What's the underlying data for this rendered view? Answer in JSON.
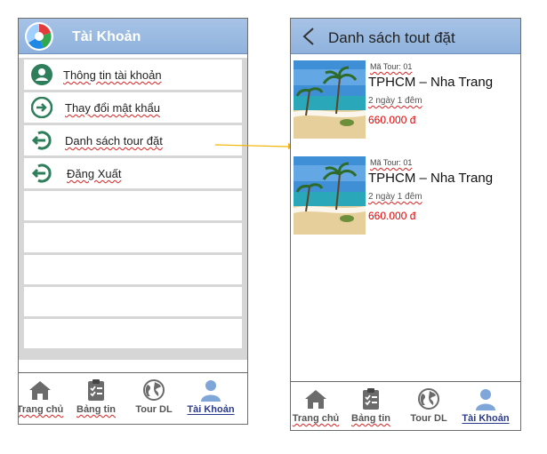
{
  "left_screen": {
    "header": {
      "title": "Tài Khoản",
      "logo_icon": "app-logo-icon"
    },
    "menu": [
      {
        "label": "Thông tin tài khoản",
        "icon": "user-icon"
      },
      {
        "label": "Thay đổi mật khẩu",
        "icon": "key-enter-icon"
      },
      {
        "label": "Danh sách tour đặt",
        "icon": "logout-arrow-icon"
      },
      {
        "label": "Đăng Xuất",
        "icon": "logout-arrow-icon"
      }
    ],
    "tabs": [
      {
        "label": "Trang chủ",
        "icon": "home-icon",
        "active": false
      },
      {
        "label": "Bảng tin",
        "icon": "clipboard-icon",
        "active": false
      },
      {
        "label": "Tour DL",
        "icon": "globe-icon",
        "active": false
      },
      {
        "label": "Tài Khoản",
        "icon": "person-icon",
        "active": true
      }
    ]
  },
  "right_screen": {
    "header": {
      "title": "Danh sách tout đặt",
      "back_icon": "back-chevron-icon"
    },
    "tours": [
      {
        "code": "Mã Tour: 01",
        "name": "TPHCM – Nha Trang",
        "duration": "2 ngày 1 đêm",
        "price": "660.000 đ"
      },
      {
        "code": "Mã Tour: 01",
        "name": "TPHCM – Nha Trang",
        "duration": "2 ngày 1 đêm",
        "price": "660.000 đ"
      }
    ],
    "tabs": [
      {
        "label": "Trang chủ",
        "icon": "home-icon",
        "active": false
      },
      {
        "label": "Bảng tin",
        "icon": "clipboard-icon",
        "active": false
      },
      {
        "label": "Tour DL",
        "icon": "globe-icon",
        "active": false
      },
      {
        "label": "Tài Khoản",
        "icon": "person-icon",
        "active": true
      }
    ]
  },
  "colors": {
    "header": "#9bbbe3",
    "icon_green": "#2e7d5b",
    "price": "#e00000",
    "active_tab": "#2b3a8c",
    "arrow": "#f2b400"
  }
}
